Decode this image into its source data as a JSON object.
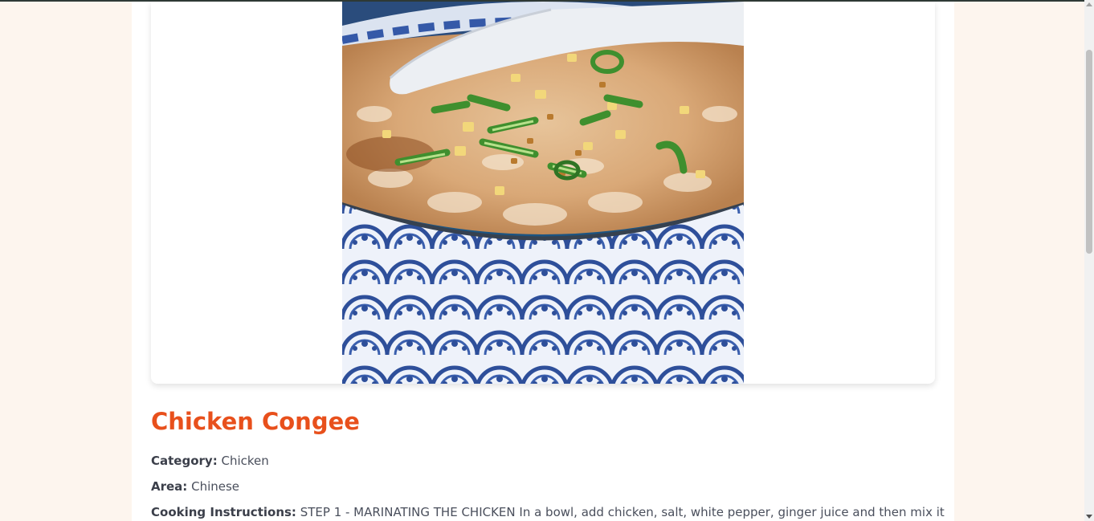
{
  "meal": {
    "title": "Chicken Congee",
    "image_alt": "Chicken Congee",
    "category_label": "Category:",
    "category": "Chicken",
    "area_label": "Area:",
    "area": "Chinese",
    "instructions_label": "Cooking Instructions:",
    "instructions": "STEP 1 - MARINATING THE CHICKEN In a bowl, add chicken, salt, white pepper, ginger juice and then mix it"
  },
  "colors": {
    "page_background": "#fdf5ee",
    "title": "#e8501c",
    "card": "#ffffff"
  }
}
